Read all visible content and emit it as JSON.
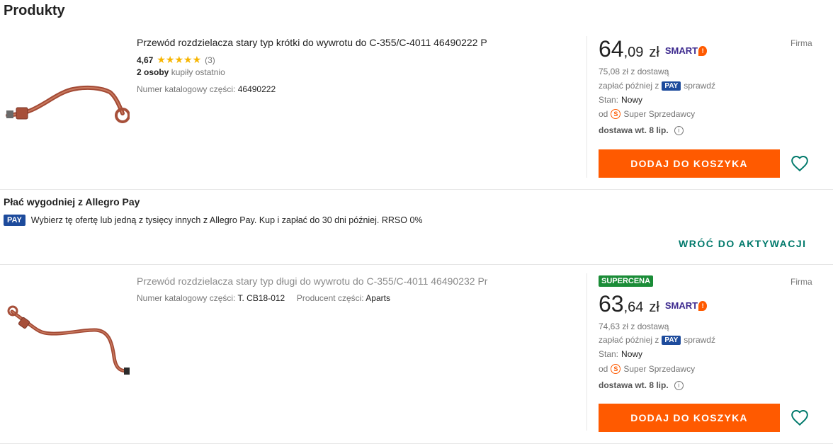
{
  "section_title": "Produkty",
  "product1": {
    "title": "Przewód rozdzielacza stary typ krótki do wywrotu do C-355/C-4011 46490222 P",
    "rating": "4,67",
    "stars": "★★★★★",
    "rating_count": "(3)",
    "bought_bold": "2 osoby",
    "bought_rest": "kupiły ostatnio",
    "catalog_label": "Numer katalogowy części:",
    "catalog_value": "46490222",
    "price_int": "64",
    "price_dec": ",09",
    "currency": "zł",
    "smart": "SMART",
    "with_delivery": "75,08 zł z dostawą",
    "pay_later": "zapłać później z",
    "pay_badge": "PAY",
    "pay_check": "sprawdź",
    "condition_label": "Stan:",
    "condition_value": "Nowy",
    "seller_prefix": "od",
    "seller": "Super Sprzedawcy",
    "delivery": "dostawa wt. 8 lip.",
    "add_to_cart": "DODAJ DO KOSZYKA",
    "firm": "Firma"
  },
  "allegro_pay": {
    "title": "Płać wygodniej z Allegro Pay",
    "badge": "PAY",
    "description": "Wybierz tę ofertę lub jedną z tysięcy innych z Allegro Pay. Kup i zapłać do 30 dni później. RRSO 0%",
    "back_link": "WRÓĆ DO AKTYWACJI"
  },
  "product2": {
    "title": "Przewód rozdzielacza stary typ długi do wywrotu do C-355/C-4011 46490232 Pr",
    "catalog_label": "Numer katalogowy części:",
    "catalog_value": "T. CB18-012",
    "producer_label": "Producent części:",
    "producer_value": "Aparts",
    "badge": "SUPERCENA",
    "price_int": "63",
    "price_dec": ",64",
    "currency": "zł",
    "smart": "SMART",
    "with_delivery": "74,63 zł z dostawą",
    "pay_later": "zapłać później z",
    "pay_badge": "PAY",
    "pay_check": "sprawdź",
    "condition_label": "Stan:",
    "condition_value": "Nowy",
    "seller_prefix": "od",
    "seller": "Super Sprzedawcy",
    "delivery": "dostawa wt. 8 lip.",
    "add_to_cart": "DODAJ DO KOSZYKA",
    "firm": "Firma"
  },
  "colors": {
    "accent": "#ff5a00",
    "teal": "#00796b",
    "pay_blue": "#1d4b9c",
    "star": "#f7b500",
    "supercena": "#1a8c37"
  },
  "icons": {
    "smart_logo": "smart-icon",
    "seller_badge": "super-seller-icon",
    "info": "info-icon",
    "wishlist": "heart-icon"
  }
}
